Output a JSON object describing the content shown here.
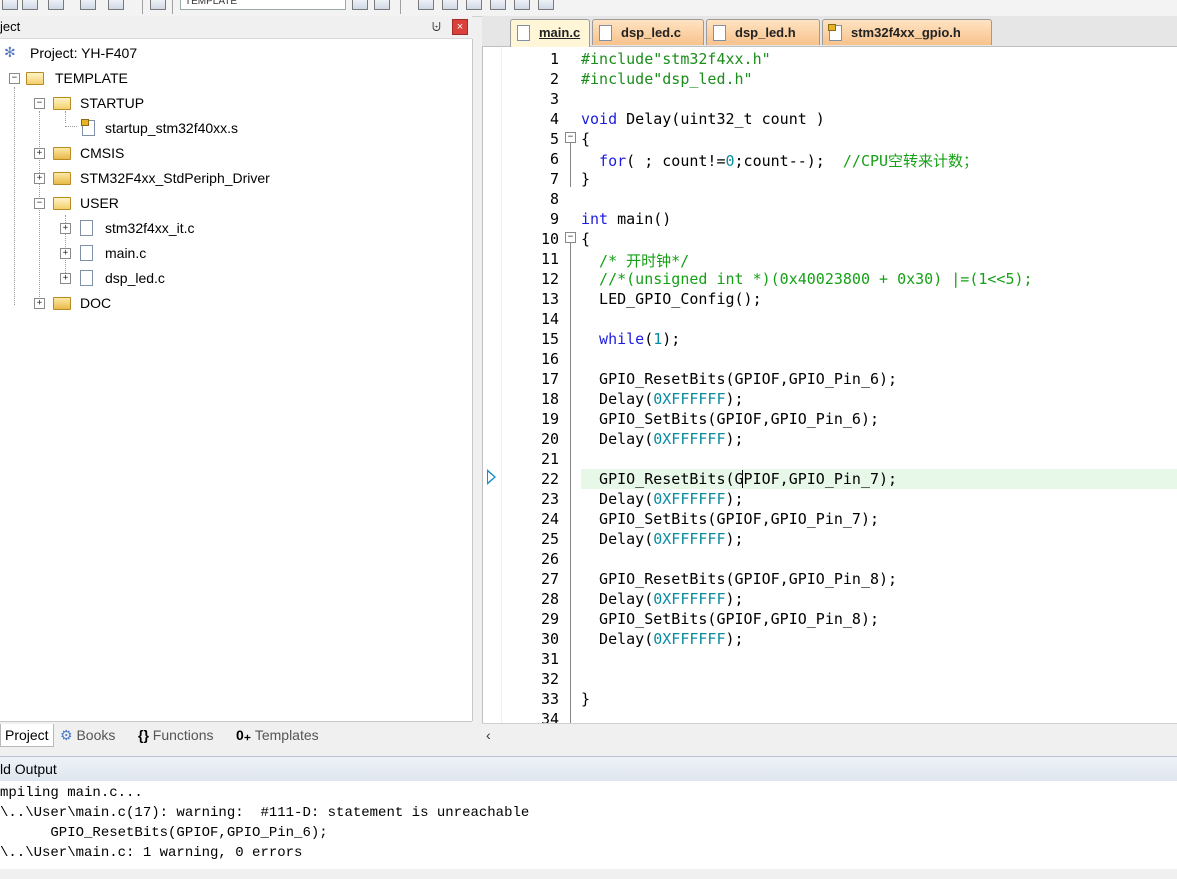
{
  "toolbar": {
    "target": "TEMPLATE"
  },
  "project_panel": {
    "title": "ject",
    "pin": "⨄",
    "close": "×",
    "tree": {
      "project": "Project: YH-F407",
      "template": "TEMPLATE",
      "startup": "STARTUP",
      "startup_file": "startup_stm32f40xx.s",
      "cmsis": "CMSIS",
      "driver": "STM32F4xx_StdPeriph_Driver",
      "user": "USER",
      "user_file1": "stm32f4xx_it.c",
      "user_file2": "main.c",
      "user_file3": "dsp_led.c",
      "doc": "DOC"
    },
    "tabs": {
      "project": "Project",
      "books": "Books",
      "functions": "Functions",
      "templates": "Templates"
    }
  },
  "editor": {
    "tabs": [
      "main.c",
      "dsp_led.c",
      "dsp_led.h",
      "stm32f4xx_gpio.h"
    ],
    "lines": {
      "l1": "#include\"stm32f4xx.h\"",
      "l2": "#include\"dsp_led.h\"",
      "l4a": "void",
      "l4b": " Delay(uint32_t count )",
      "l5": "{",
      "l6a": "  for",
      "l6b": "( ; count!=",
      "l6c": "0",
      "l6d": ";count--);  ",
      "l6e": "//CPU空转来计数；",
      "l7": "}",
      "l9a": "int",
      "l9b": " main()",
      "l10": "{",
      "l11": "  /* 开时钟*/",
      "l12": "  //*(unsigned int *)(0x40023800 + 0x30) |=(1<<5);",
      "l13": "  LED_GPIO_Config();",
      "l15a": "  while",
      "l15b": "(",
      "l15c": "1",
      "l15d": ");",
      "l17": "  GPIO_ResetBits(GPIOF,GPIO_Pin_6);",
      "l18a": "  Delay(",
      "l18b": "0XFFFFFF",
      "l18c": ");",
      "l19": "  GPIO_SetBits(GPIOF,GPIO_Pin_6);",
      "l20a": "  Delay(",
      "l20b": "0XFFFFFF",
      "l20c": ");",
      "l22": "  GPIO_ResetBits(GPIOF,GPIO_Pin_7);",
      "l23a": "  Delay(",
      "l23b": "0XFFFFFF",
      "l23c": ");",
      "l24": "  GPIO_SetBits(GPIOF,GPIO_Pin_7);",
      "l25a": "  Delay(",
      "l25b": "0XFFFFFF",
      "l25c": ");",
      "l27": "  GPIO_ResetBits(GPIOF,GPIO_Pin_8);",
      "l28a": "  Delay(",
      "l28b": "0XFFFFFF",
      "l28c": ");",
      "l29": "  GPIO_SetBits(GPIOF,GPIO_Pin_8);",
      "l30a": "  Delay(",
      "l30b": "0XFFFFFF",
      "l30c": ");",
      "l33": "}"
    }
  },
  "build_output": {
    "title": "ld Output",
    "lines": [
      "mpiling main.c...",
      "\\..\\User\\main.c(17): warning:  #111-D: statement is unreachable",
      "      GPIO_ResetBits(GPIOF,GPIO_Pin_6);",
      "\\..\\User\\main.c: 1 warning, 0 errors"
    ]
  }
}
